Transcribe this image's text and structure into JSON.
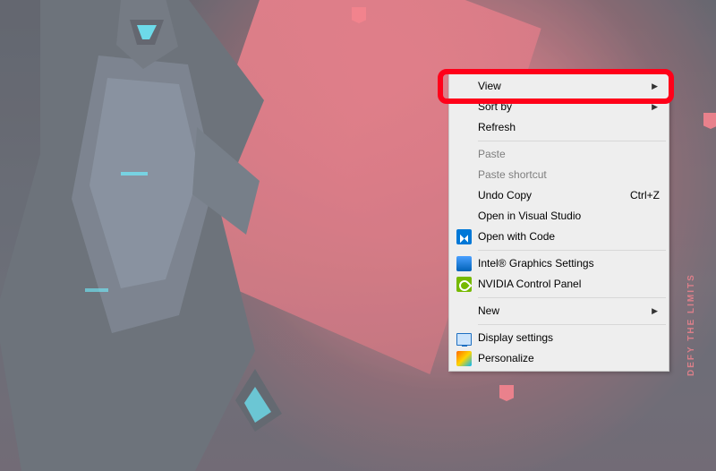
{
  "wallpaper": {
    "vertical_text": "DEFY THE LIMITS",
    "credit_text": ""
  },
  "context_menu": {
    "items": {
      "view": {
        "label": "View"
      },
      "sort_by": {
        "label": "Sort by"
      },
      "refresh": {
        "label": "Refresh"
      },
      "paste": {
        "label": "Paste"
      },
      "paste_shortcut": {
        "label": "Paste shortcut"
      },
      "undo_copy": {
        "label": "Undo Copy",
        "shortcut": "Ctrl+Z"
      },
      "open_vs": {
        "label": "Open in Visual Studio"
      },
      "open_code": {
        "label": "Open with Code"
      },
      "intel": {
        "label": "Intel® Graphics Settings"
      },
      "nvidia": {
        "label": "NVIDIA Control Panel"
      },
      "new": {
        "label": "New"
      },
      "display": {
        "label": "Display settings"
      },
      "personalize": {
        "label": "Personalize"
      }
    }
  }
}
